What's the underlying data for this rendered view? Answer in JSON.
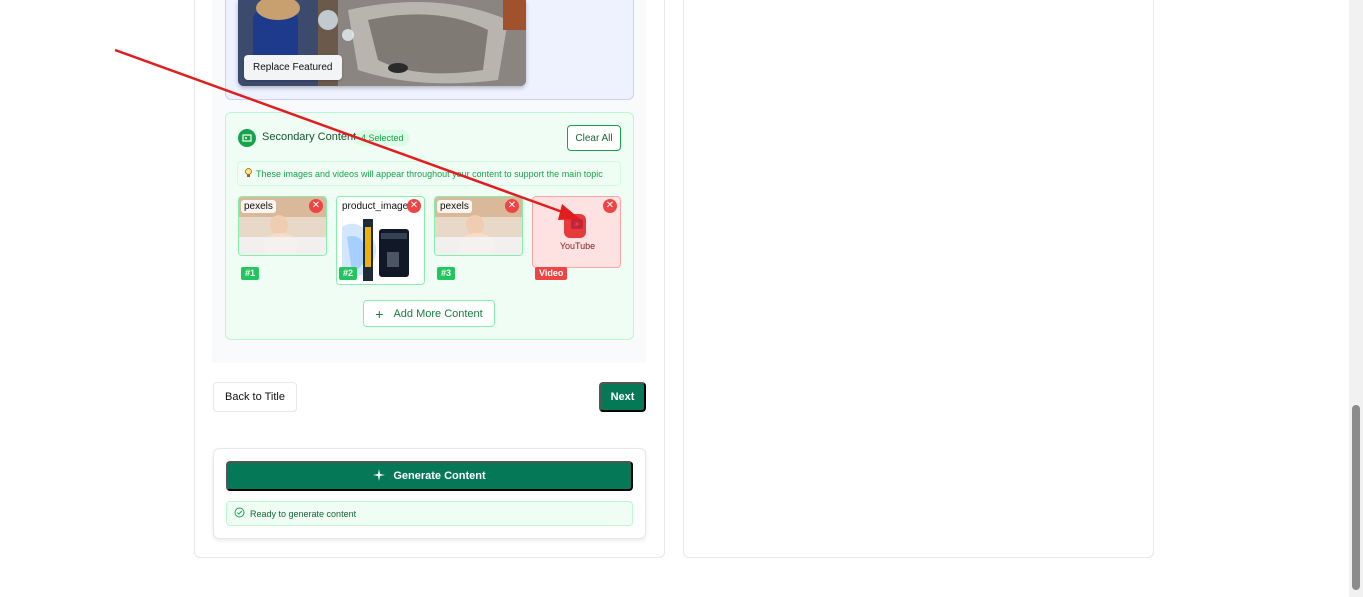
{
  "featured": {
    "replace_label": "Replace Featured"
  },
  "secondary": {
    "title": "Secondary Content",
    "selected_count": "4 Selected",
    "clear_label": "Clear All",
    "tip": "These images and videos will appear throughout your content to support the main topic",
    "items": [
      {
        "source": "pexels",
        "badge": "#1"
      },
      {
        "source": "product_image",
        "badge": "#2"
      },
      {
        "source": "pexels",
        "badge": "#3"
      },
      {
        "source": "YouTube",
        "badge": "Video"
      }
    ],
    "add_more_label": "Add More Content"
  },
  "nav": {
    "back_label": "Back to Title",
    "next_label": "Next"
  },
  "generate": {
    "button_label": "Generate Content",
    "status": "Ready to generate content"
  },
  "colors": {
    "primary": "#047857",
    "accent_green": "#16a34a",
    "danger": "#ef4444",
    "annotation_arrow": "#e11d1d"
  }
}
